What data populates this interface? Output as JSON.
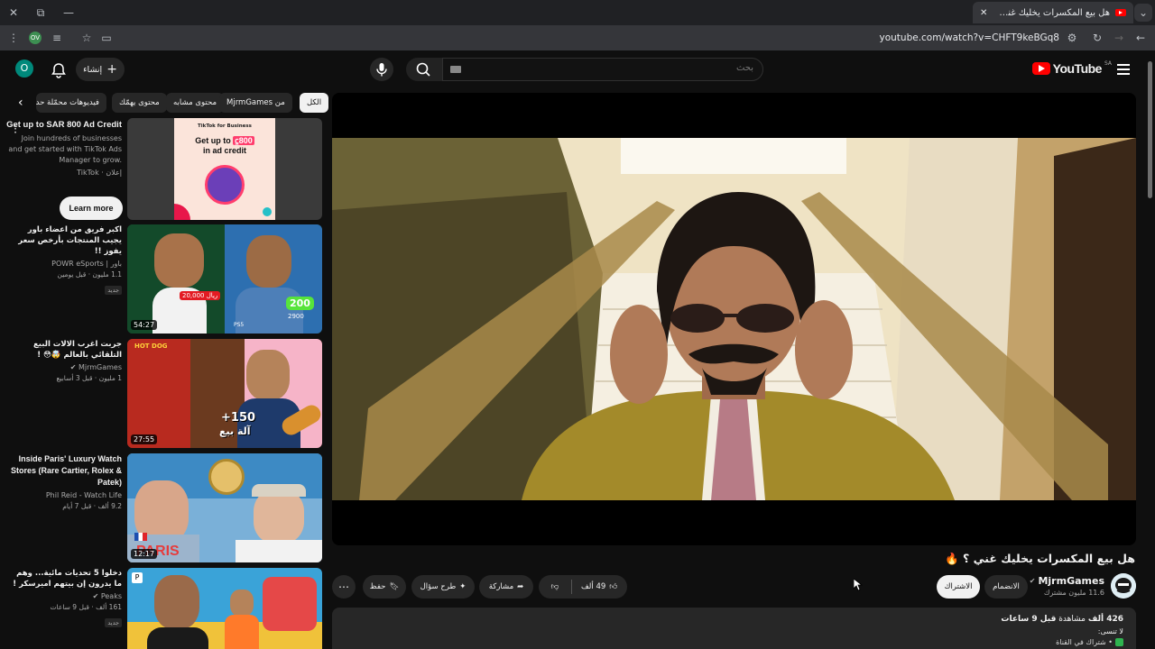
{
  "browser": {
    "tab_title": "هل بيع المكسرات يخليك غني ؟ 🔥",
    "url": "youtube.com/watch?v=CHFT9keBGq8",
    "profile_badge": "OV",
    "new_tab_glyph": "+",
    "close_tab_glyph": "✕",
    "close_window_glyph": "✕",
    "maximize_glyph": "⧉",
    "minimize_glyph": "—",
    "tab_menu_glyph": "⌄",
    "back_glyph": "←",
    "forward_glyph": "→",
    "reload_glyph": "↻",
    "menu_glyph": "⋮",
    "star_glyph": "☆",
    "reader_glyph": "≡"
  },
  "header": {
    "logo_text": "YouTube",
    "region": "SA",
    "search_placeholder": "بحث",
    "create_label": "إنشاء",
    "create_glyph": "+",
    "avatar_letter": "O"
  },
  "chips": [
    "الكل",
    "من MjrmGames",
    "محتوى مشابه",
    "محتوى يهمّك",
    "فيديوهات محمّلة حديثًا"
  ],
  "ad": {
    "title": "Get up to SAR 800 Ad Credit",
    "body": "Join hundreds of businesses and get started with TikTok Ads Manager to grow.",
    "sponsor": "إعلان · TikTok",
    "cta": "Learn more",
    "thumb_brand": "TikTok for Business",
    "thumb_line1": "Get up to",
    "thumb_amount": "800",
    "thumb_line2": "in ad credit"
  },
  "videos": [
    {
      "title": "اكبر فريق من اعضاء باور يجيب المنتجات بأرخص سعر يفوز !!",
      "channel": "باور | POWR eSports",
      "views": "1.1 مليون",
      "age": "قبل يومين",
      "badge": "جديد",
      "duration": "54:27",
      "thumb_texts": [
        "20,000 ريال",
        "200",
        "2900",
        "PS5"
      ]
    },
    {
      "title": "جربت اغرب الالات البيع التلقائي بالعالم 🤯😳 !",
      "channel": "MjrmGames",
      "views": "1 مليون",
      "age": "قبل 3 أسابيع",
      "badge": "",
      "duration": "27:55",
      "thumb_texts": [
        "+150",
        "آلة بيع",
        "HOT DOG"
      ]
    },
    {
      "title": "Inside Paris' Luxury Watch Stores (Rare Cartier, Rolex & Patek)",
      "channel": "Phil Reid - Watch Life",
      "views": "9.2 ألف",
      "age": "قبل 7 أيام",
      "badge": "",
      "duration": "12:17",
      "thumb_texts": [
        "PARIS"
      ]
    },
    {
      "title": "دخلوا 5 تحديات مائية... وهم ما يدرون إن بيتهم اميرسكر !",
      "channel": "Peaks",
      "views": "161 ألف",
      "age": "قبل 9 ساعات",
      "badge": "جديد",
      "duration": "",
      "thumb_texts": []
    }
  ],
  "main": {
    "title": "هل بيع المكسرات يخليك غني ؟ 🔥",
    "channel": "MjrmGames",
    "subs": "11.6 مليون مشترك",
    "join": "الانضمام",
    "subscribe": "الاشتراك",
    "likes": "49 ألف",
    "share": "مشاركة",
    "ask": "طرح سؤال",
    "save": "حفظ",
    "views": "426 ألف",
    "views_suffix": "مشاهدة",
    "age": "قبل 9 ساعات",
    "desc_line": "لا تنسى:",
    "desc_line3": "• شتراك في القناة"
  },
  "colors": {
    "background": "#0f0f0f",
    "surface": "#272727",
    "brand_red": "#ff0000",
    "text": "#f1f1f1",
    "muted": "#aaaaaa",
    "suit": "#a38a2a"
  }
}
